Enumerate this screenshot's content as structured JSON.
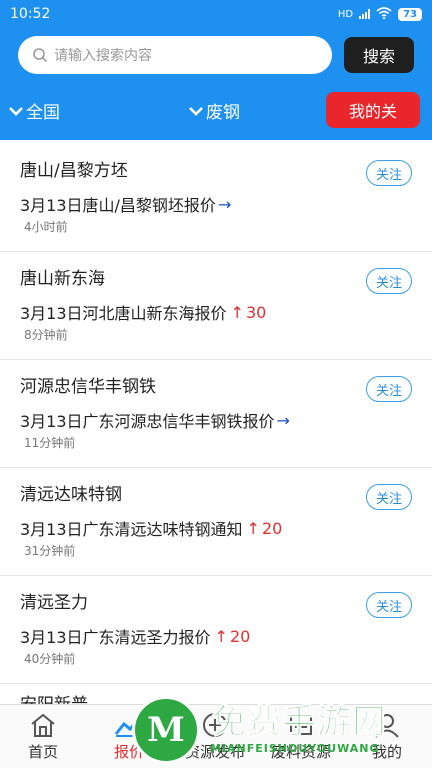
{
  "status_bar": {
    "time": "10:52",
    "network": "HD",
    "battery": "73"
  },
  "search": {
    "placeholder": "请输入搜索内容",
    "button_label": "搜索"
  },
  "filters": {
    "region": "全国",
    "category": "废钢",
    "my_follow_label": "我的关"
  },
  "follow_label": "关注",
  "items": [
    {
      "title": "唐山/昌黎方坯",
      "line": "3月13日唐山/昌黎钢坯报价",
      "trend": "flat",
      "change": "",
      "time": "4小时前"
    },
    {
      "title": "唐山新东海",
      "line": "3月13日河北唐山新东海报价",
      "trend": "up",
      "change": "30",
      "time": "8分钟前"
    },
    {
      "title": "河源忠信华丰钢铁",
      "line": "3月13日广东河源忠信华丰钢铁报价",
      "trend": "flat",
      "change": "",
      "time": "11分钟前"
    },
    {
      "title": "清远达味特钢",
      "line": "3月13日广东清远达味特钢通知",
      "trend": "up",
      "change": "20",
      "time": "31分钟前"
    },
    {
      "title": "清远圣力",
      "line": "3月13日广东清远圣力报价",
      "trend": "up",
      "change": "20",
      "time": "40分钟前"
    }
  ],
  "partial_item": {
    "title": "安阳新普"
  },
  "tabs": [
    {
      "label": "首页",
      "icon": "home-icon",
      "active": false
    },
    {
      "label": "报价",
      "icon": "chart-icon",
      "active": true
    },
    {
      "label": "资源发布",
      "icon": "publish-icon",
      "active": false
    },
    {
      "label": "废料资源",
      "icon": "resource-icon",
      "active": false
    },
    {
      "label": "我的",
      "icon": "user-icon",
      "active": false
    }
  ],
  "watermark": {
    "text": "免费手游网",
    "url": "MIANFEISHOUYOUWANG"
  },
  "colors": {
    "header_blue": "#1e90f0",
    "accent_red": "#e8262b",
    "follow_blue": "#39a0e8",
    "watermark_green": "#2ea843"
  }
}
